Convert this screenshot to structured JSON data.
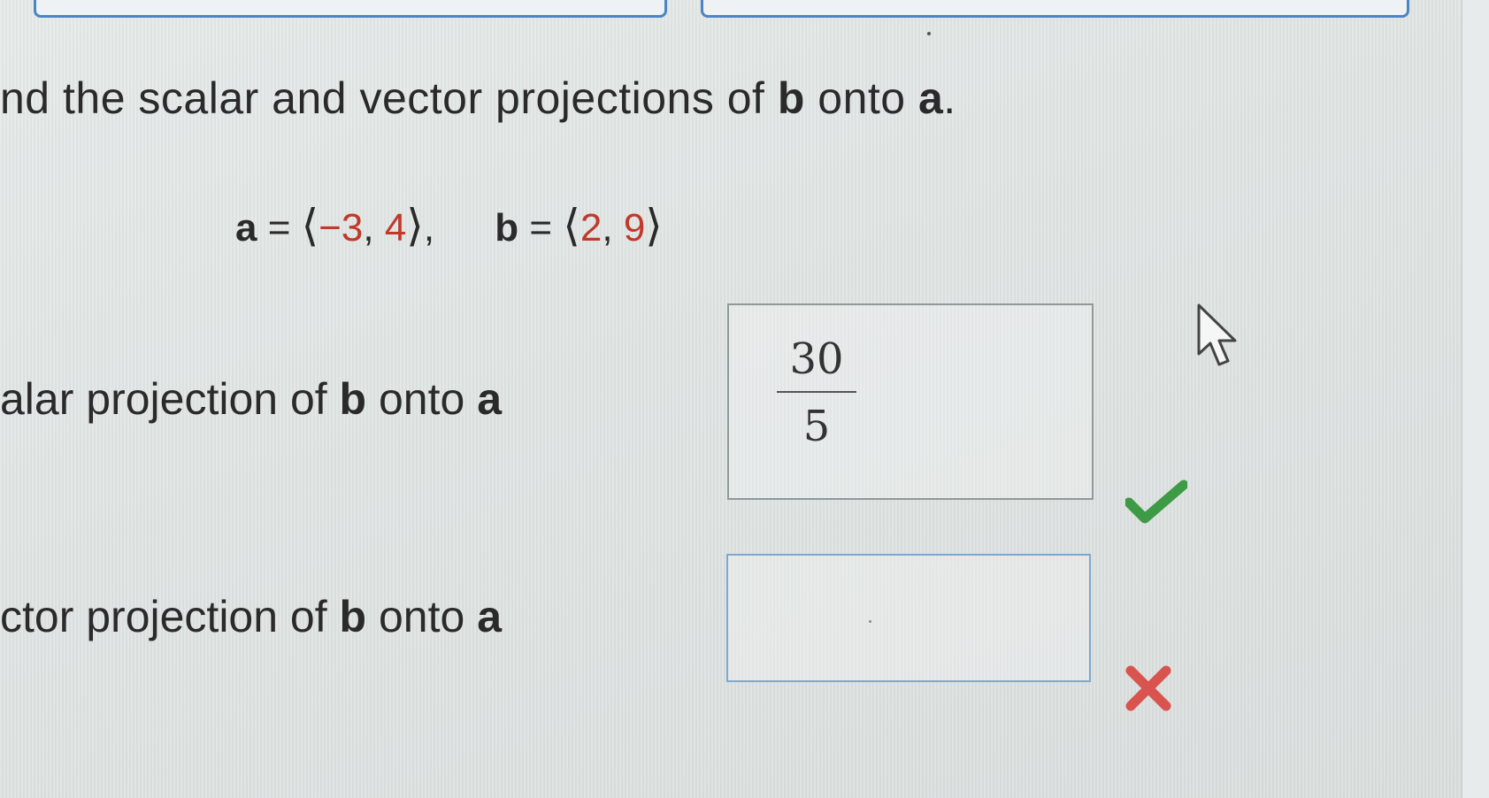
{
  "question": {
    "prefix": "nd the scalar and vector projections of ",
    "b": "b",
    "middle": " onto ",
    "a": "a",
    "end": "."
  },
  "vectors": {
    "a_name": "a",
    "equals": "=",
    "a_open": "⟨",
    "a_x": "−3",
    "a_y": "4",
    "a_close": "⟩",
    "b_name": "b",
    "b_open": "⟨",
    "b_x": "2",
    "b_y": "9",
    "b_close": "⟩",
    "comma": ",",
    "sep": ","
  },
  "scalar": {
    "label_prefix": "alar projection of ",
    "b": "b",
    "middle": " onto ",
    "a": "a",
    "answer_numerator": "30",
    "answer_denominator": "5",
    "status": "correct"
  },
  "vector": {
    "label_prefix": "ctor projection of ",
    "b": "b",
    "middle": " onto ",
    "a": "a",
    "answer_value": "",
    "status": "incorrect"
  },
  "colors": {
    "number_red": "#c0392b",
    "check_green": "#3d9a45",
    "cross_red": "#d9534f",
    "button_blue": "#4a86c5"
  },
  "icons": {
    "check": "check-icon",
    "cross": "cross-icon",
    "cursor": "mouse-pointer-icon"
  }
}
